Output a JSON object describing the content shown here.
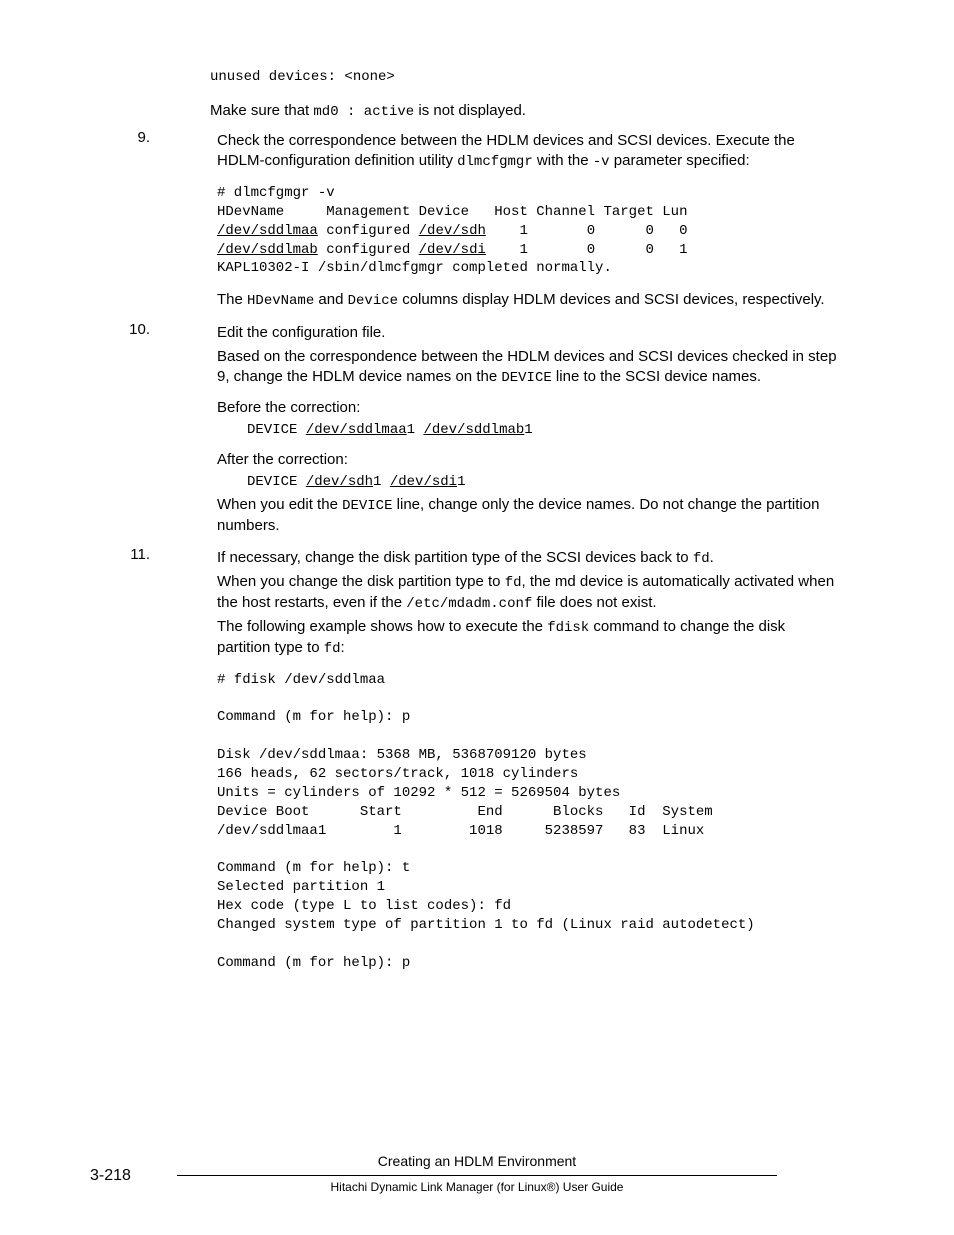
{
  "pre_line": "unused devices: <none>",
  "pre_text_1a": "Make sure that ",
  "pre_code_1": "md0 : active",
  "pre_text_1b": " is not displayed.",
  "step9": {
    "num": "9.",
    "text_a": "Check the correspondence between the HDLM devices and SCSI devices. Execute the HDLM-configuration definition utility ",
    "code_a": "dlmcfgmgr",
    "text_b": " with the ",
    "code_b": "-v",
    "text_c": " parameter specified:",
    "block_l1": "# dlmcfgmgr -v",
    "block_l2": "HDevName     Management Device   Host Channel Target Lun",
    "block_l3a": "/dev/sddlmaa",
    "block_l3b": " configured ",
    "block_l3c": "/dev/sdh",
    "block_l3d": "    1       0      0   0",
    "block_l4a": "/dev/sddlmab",
    "block_l4b": " configured ",
    "block_l4c": "/dev/sdi",
    "block_l4d": "    1       0      0   1",
    "block_l5": "KAPL10302-I /sbin/dlmcfgmgr completed normally.",
    "after_a": "The ",
    "after_code1": "HDevName",
    "after_b": " and ",
    "after_code2": "Device",
    "after_c": " columns display HDLM devices and SCSI devices, respectively."
  },
  "step10": {
    "num": "10.",
    "line1": "Edit the configuration file.",
    "p2_a": "Based on the correspondence between the HDLM devices and SCSI devices checked in step 9, change the HDLM device names on the ",
    "p2_code": "DEVICE",
    "p2_b": " line to the SCSI device names.",
    "before_label": "Before the correction:",
    "before_code_a": "DEVICE ",
    "before_code_b": "/dev/sddlmaa",
    "before_code_c": "1 ",
    "before_code_d": "/dev/sddlmab",
    "before_code_e": "1",
    "after_label": "After the correction:",
    "after_code_a": "DEVICE ",
    "after_code_b": "/dev/sdh",
    "after_code_c": "1 ",
    "after_code_d": "/dev/sdi",
    "after_code_e": "1",
    "p3_a": "When you edit the ",
    "p3_code": "DEVICE",
    "p3_b": " line, change only the device names. Do not change the partition numbers."
  },
  "step11": {
    "num": "11.",
    "p1_a": "If necessary, change the disk partition type of the SCSI devices back to ",
    "p1_code": "fd",
    "p1_b": ".",
    "p2_a": "When you change the disk partition type to ",
    "p2_code1": "fd",
    "p2_b": ", the md device is automatically activated when the host restarts, even if the ",
    "p2_code2": "/etc/mdadm.conf",
    "p2_c": " file does not exist.",
    "p3_a": "The following example shows how to execute the ",
    "p3_code1": "fdisk",
    "p3_b": " command to change the disk partition type to ",
    "p3_code2": "fd",
    "p3_c": ":",
    "block": "# fdisk /dev/sddlmaa\n\nCommand (m for help): p\n\nDisk /dev/sddlmaa: 5368 MB, 5368709120 bytes\n166 heads, 62 sectors/track, 1018 cylinders\nUnits = cylinders of 10292 * 512 = 5269504 bytes\nDevice Boot      Start         End      Blocks   Id  System\n/dev/sddlmaa1        1        1018     5238597   83  Linux\n\nCommand (m for help): t\nSelected partition 1\nHex code (type L to list codes): fd\nChanged system type of partition 1 to fd (Linux raid autodetect)\n\nCommand (m for help): p"
  },
  "page_num": "3-218",
  "footer_title": "Creating an HDLM Environment",
  "footer_sub": "Hitachi Dynamic Link Manager (for Linux®) User Guide"
}
